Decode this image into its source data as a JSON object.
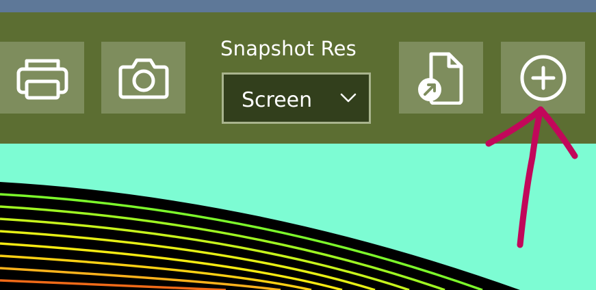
{
  "app": {
    "title_bar_color": "#5e7898",
    "toolbar_color": "#5c6e32",
    "canvas_background": "#7dfcd3"
  },
  "toolbar": {
    "print_button": {
      "icon": "printer-icon"
    },
    "snapshot_button": {
      "icon": "camera-icon"
    },
    "snapshot_res": {
      "label": "Snapshot Res",
      "selected": "Screen",
      "icon": "chevron-down-icon"
    },
    "share_button": {
      "icon": "share-file-icon"
    },
    "add_button": {
      "icon": "add-circle-icon"
    }
  },
  "annotation": {
    "type": "hand-drawn arrow",
    "color": "#c2075a",
    "points_to": "add_button"
  },
  "canvas": {
    "shape": "curved spectral bands",
    "band_colors": [
      "#7cf82b",
      "#c7f31c",
      "#f6ea12",
      "#fbb21c",
      "#f06a18"
    ]
  }
}
